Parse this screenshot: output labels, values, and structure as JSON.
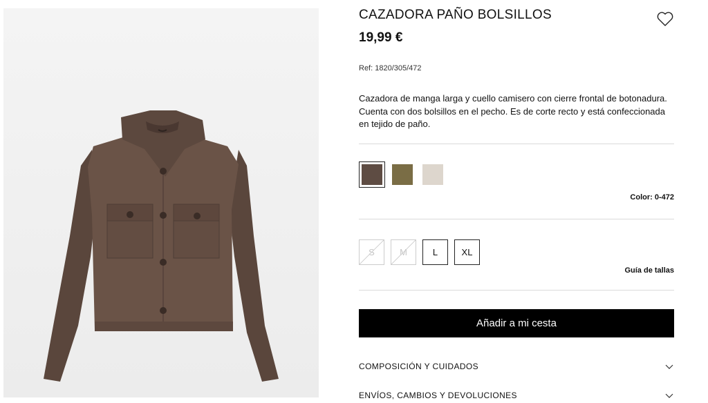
{
  "product": {
    "title": "CAZADORA PAÑO BOLSILLOS",
    "price": "19,99 €",
    "ref": "Ref: 1820/305/472",
    "description": "Cazadora de manga larga y cuello camisero con cierre frontal de botonadura. Cuenta con dos bolsillos en el pecho. Es de corte recto y está confeccionada en tejido de paño.",
    "image_alt": "brown wool jacket"
  },
  "icons": {
    "wishlist": "heart-icon",
    "accordion": "chevron-down-icon"
  },
  "colors": {
    "swatches": [
      {
        "name": "brown",
        "hex": "#5e4c43",
        "selected": true
      },
      {
        "name": "khaki",
        "hex": "#7a6d45",
        "selected": false
      },
      {
        "name": "cream",
        "hex": "#ddd6cd",
        "selected": false
      }
    ],
    "selected_label": "Color: 0-472"
  },
  "sizes": [
    {
      "label": "S",
      "available": false
    },
    {
      "label": "M",
      "available": false
    },
    {
      "label": "L",
      "available": true
    },
    {
      "label": "XL",
      "available": true
    }
  ],
  "size_guide": "Guía de tallas",
  "add_to_cart": "Añadir a mi cesta",
  "accordion": [
    {
      "label": "COMPOSICIÓN Y CUIDADOS"
    },
    {
      "label": "ENVÍOS, CAMBIOS Y DEVOLUCIONES"
    }
  ]
}
